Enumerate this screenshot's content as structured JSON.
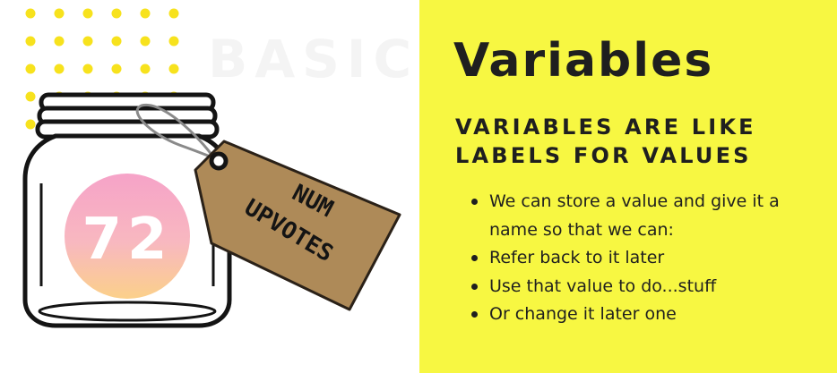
{
  "slide": {
    "title": "Variables",
    "subtitle": "VARIABLES ARE LIKE LABELS FOR VALUES",
    "bullets": [
      "We can store a value and give it a name so that we can:",
      "Refer back to it later",
      "Use that value to do...stuff",
      "Or change it later one"
    ]
  },
  "illustration": {
    "watermark": "BASIC",
    "jar_value": "72",
    "tag_line1": "NUM",
    "tag_line2": "UPVOTES",
    "colors": {
      "dots": "#f7e21d",
      "tag": "#ae8a58",
      "circle_top": "#f6a3c8",
      "circle_bottom": "#fbd08a",
      "panel": "#f7f742"
    }
  }
}
